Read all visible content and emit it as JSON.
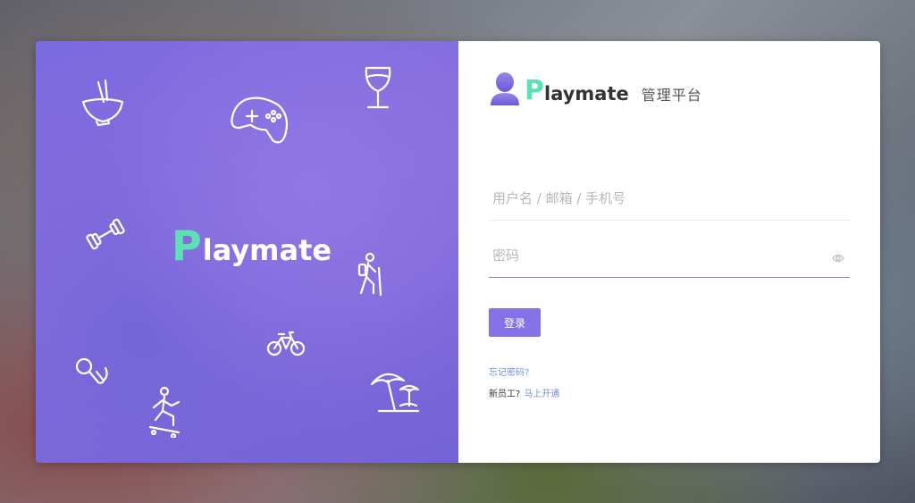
{
  "hero": {
    "brand_first": "P",
    "brand_rest": "laymate",
    "doodles": [
      "bowl-icon",
      "game-controller-icon",
      "wine-glass-icon",
      "dumbbell-icon",
      "hiker-icon",
      "bicycle-icon",
      "microphone-icon",
      "skateboarder-icon",
      "beach-umbrella-icon"
    ]
  },
  "logo": {
    "brand_first": "P",
    "brand_rest": "laymate",
    "subtitle": "管理平台"
  },
  "form": {
    "username_placeholder": "用户名 / 邮箱 / 手机号",
    "password_placeholder": "密码",
    "login_label": "登录",
    "forgot_label": "忘记密码?",
    "new_staff_label": "新员工?",
    "activate_label": "马上开通"
  },
  "colors": {
    "accent": "#8473e6",
    "brand_green": "#5ce0b4",
    "link": "#6f8fd8"
  }
}
